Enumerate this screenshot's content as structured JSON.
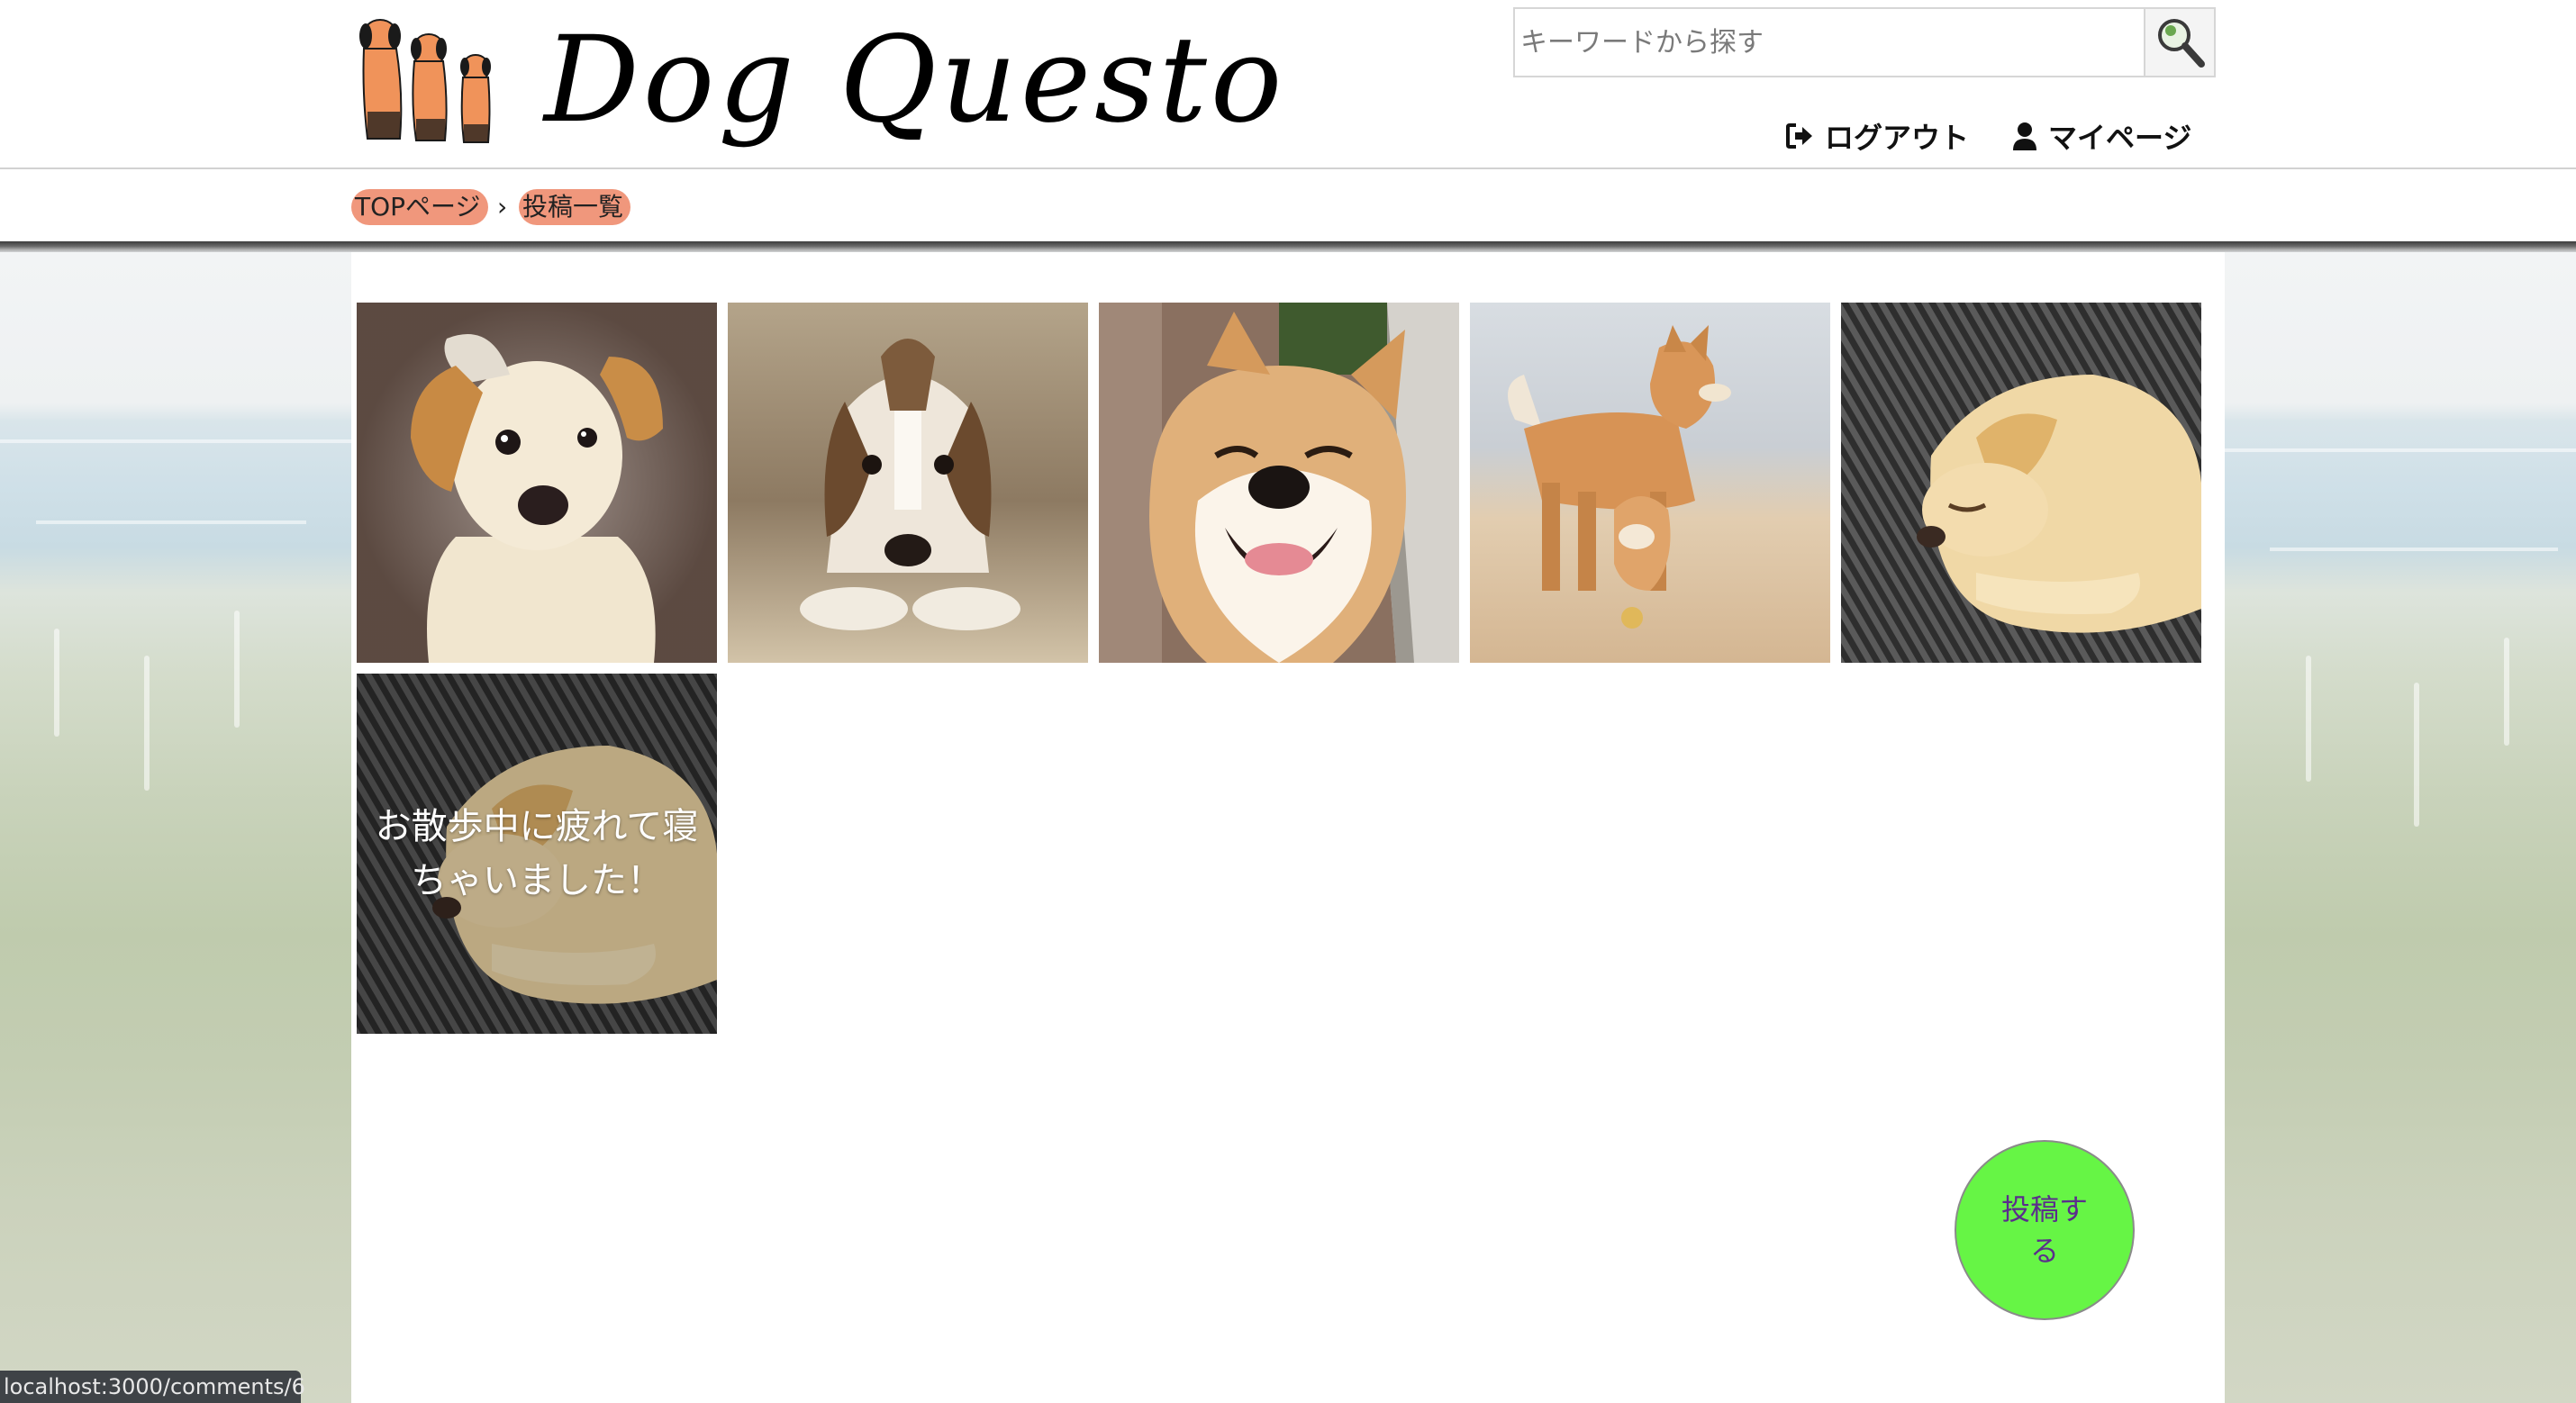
{
  "header": {
    "logo_text": "Dog Questo",
    "search_placeholder": "キーワードから探す",
    "nav": {
      "logout_label": "ログアウト",
      "mypage_label": "マイページ"
    }
  },
  "breadcrumb": {
    "items": [
      "TOPページ",
      "投稿一覧"
    ],
    "separator": "›"
  },
  "posts": [
    {
      "photo": "labrador-mix-head-tilt"
    },
    {
      "photo": "beagle-puppy-lying"
    },
    {
      "photo": "smiling-shiba"
    },
    {
      "photo": "shiba-and-puppy-on-sand"
    },
    {
      "photo": "golden-puppy-sleeping"
    },
    {
      "photo": "golden-puppy-sleeping-hover",
      "caption": "お散歩中に疲れて寝ちゃいました！"
    }
  ],
  "post_button": {
    "label": "投稿する"
  },
  "status_bar": {
    "url": "localhost:3000/comments/6"
  },
  "colors": {
    "breadcrumb_bg": "#f0977c",
    "post_button_bg": "#66f545",
    "post_button_text": "#5b2e8c",
    "logo_dog": "#f0935a"
  }
}
